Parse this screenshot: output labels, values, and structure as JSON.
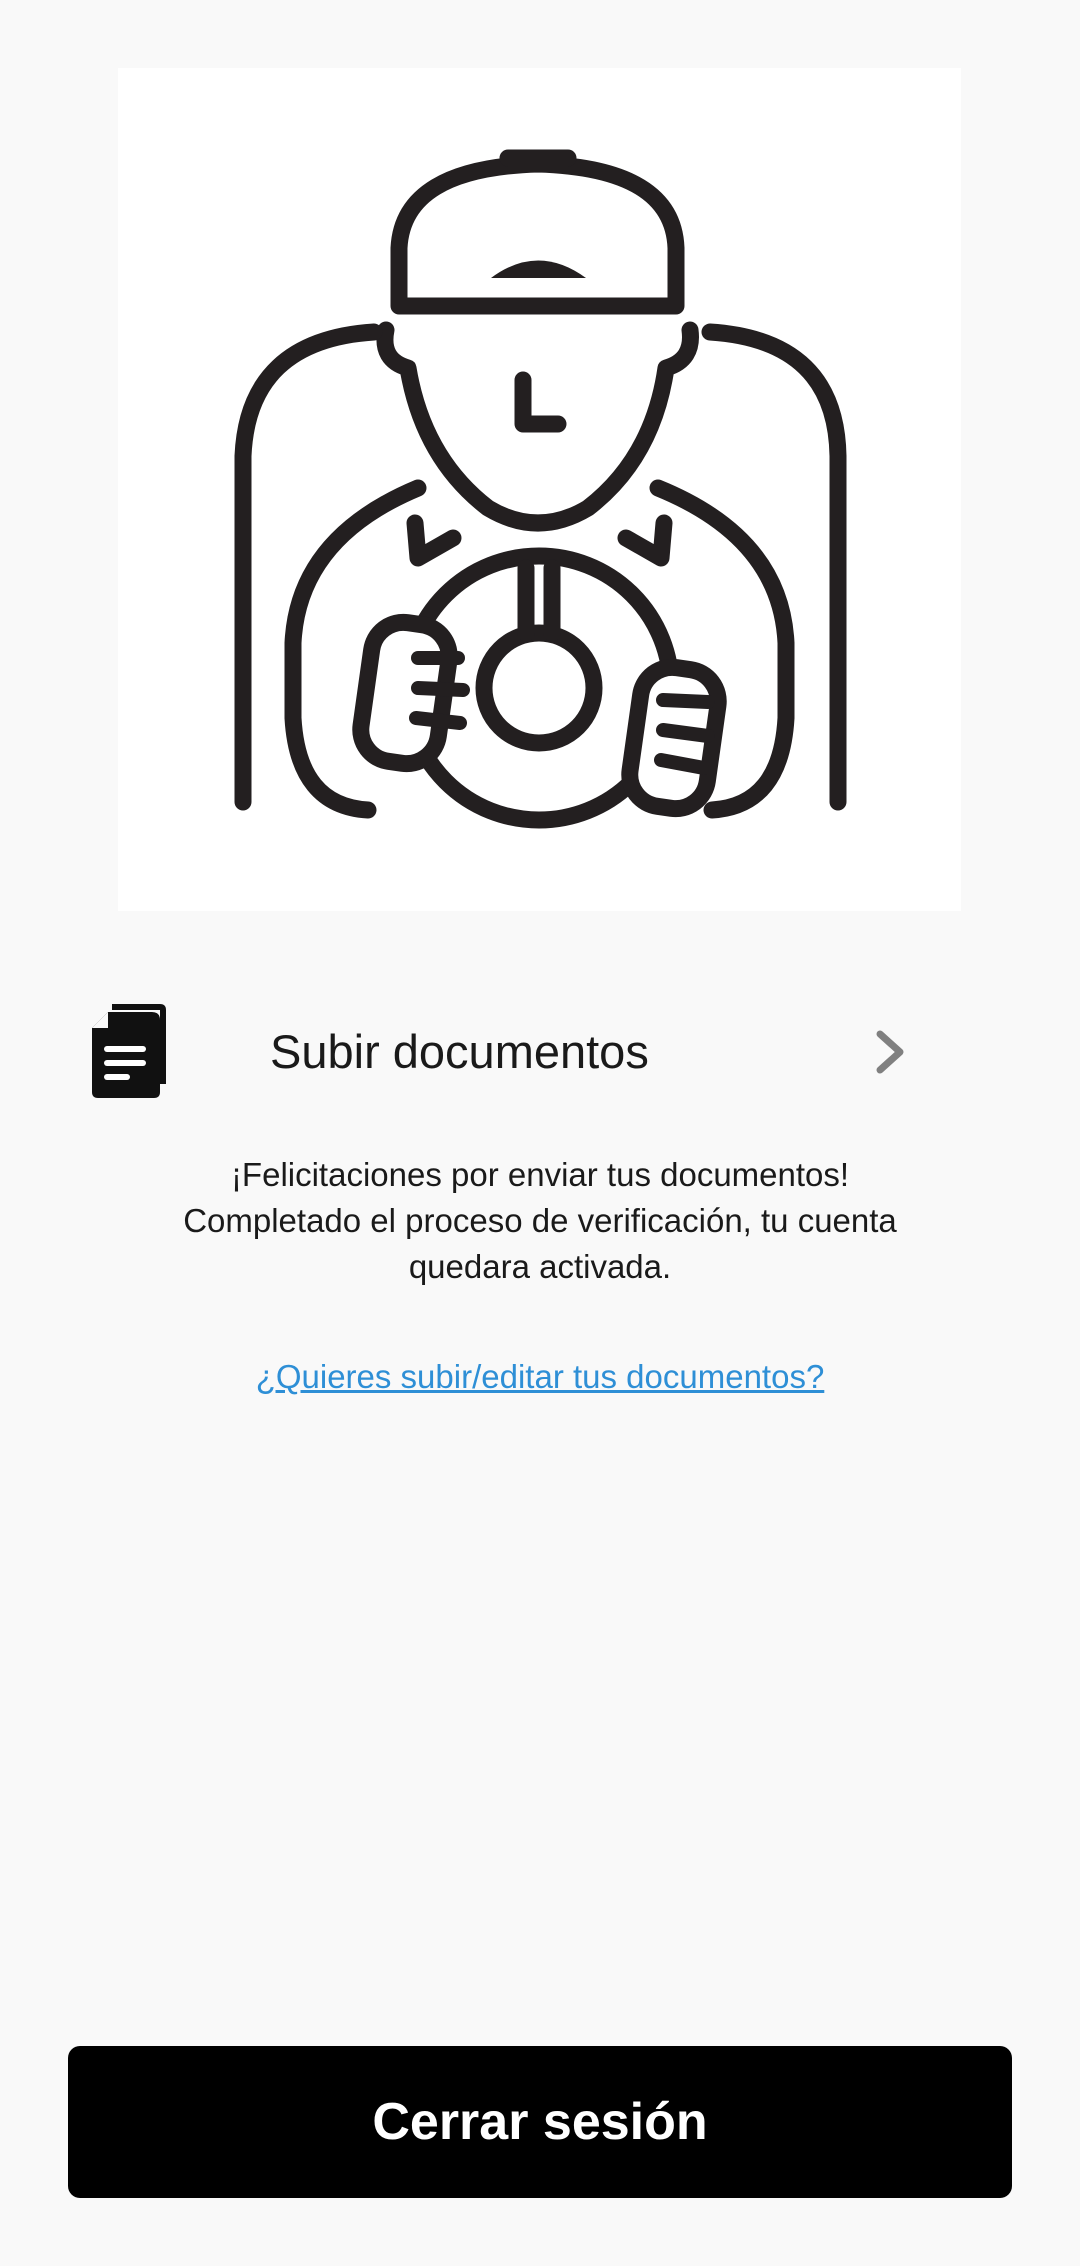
{
  "hero": {
    "icon": "driver-steering-wheel-illustration"
  },
  "upload": {
    "icon": "document-icon",
    "label": "Subir documentos",
    "chevron": "chevron-right-icon"
  },
  "message": {
    "line1": "¡Felicitaciones por enviar tus documentos!",
    "line2": "Completado el proceso de verificación, tu cuenta",
    "line3": "quedara activada."
  },
  "edit_link": {
    "label": "¿Quieres subir/editar tus documentos?"
  },
  "logout": {
    "label": "Cerrar sesión"
  },
  "colors": {
    "background": "#f9f9f9",
    "illustration_bg": "#ffffff",
    "text": "#1a1a1a",
    "link": "#2e8fd6",
    "button_bg": "#000000",
    "button_text": "#ffffff",
    "chevron": "#808080"
  }
}
